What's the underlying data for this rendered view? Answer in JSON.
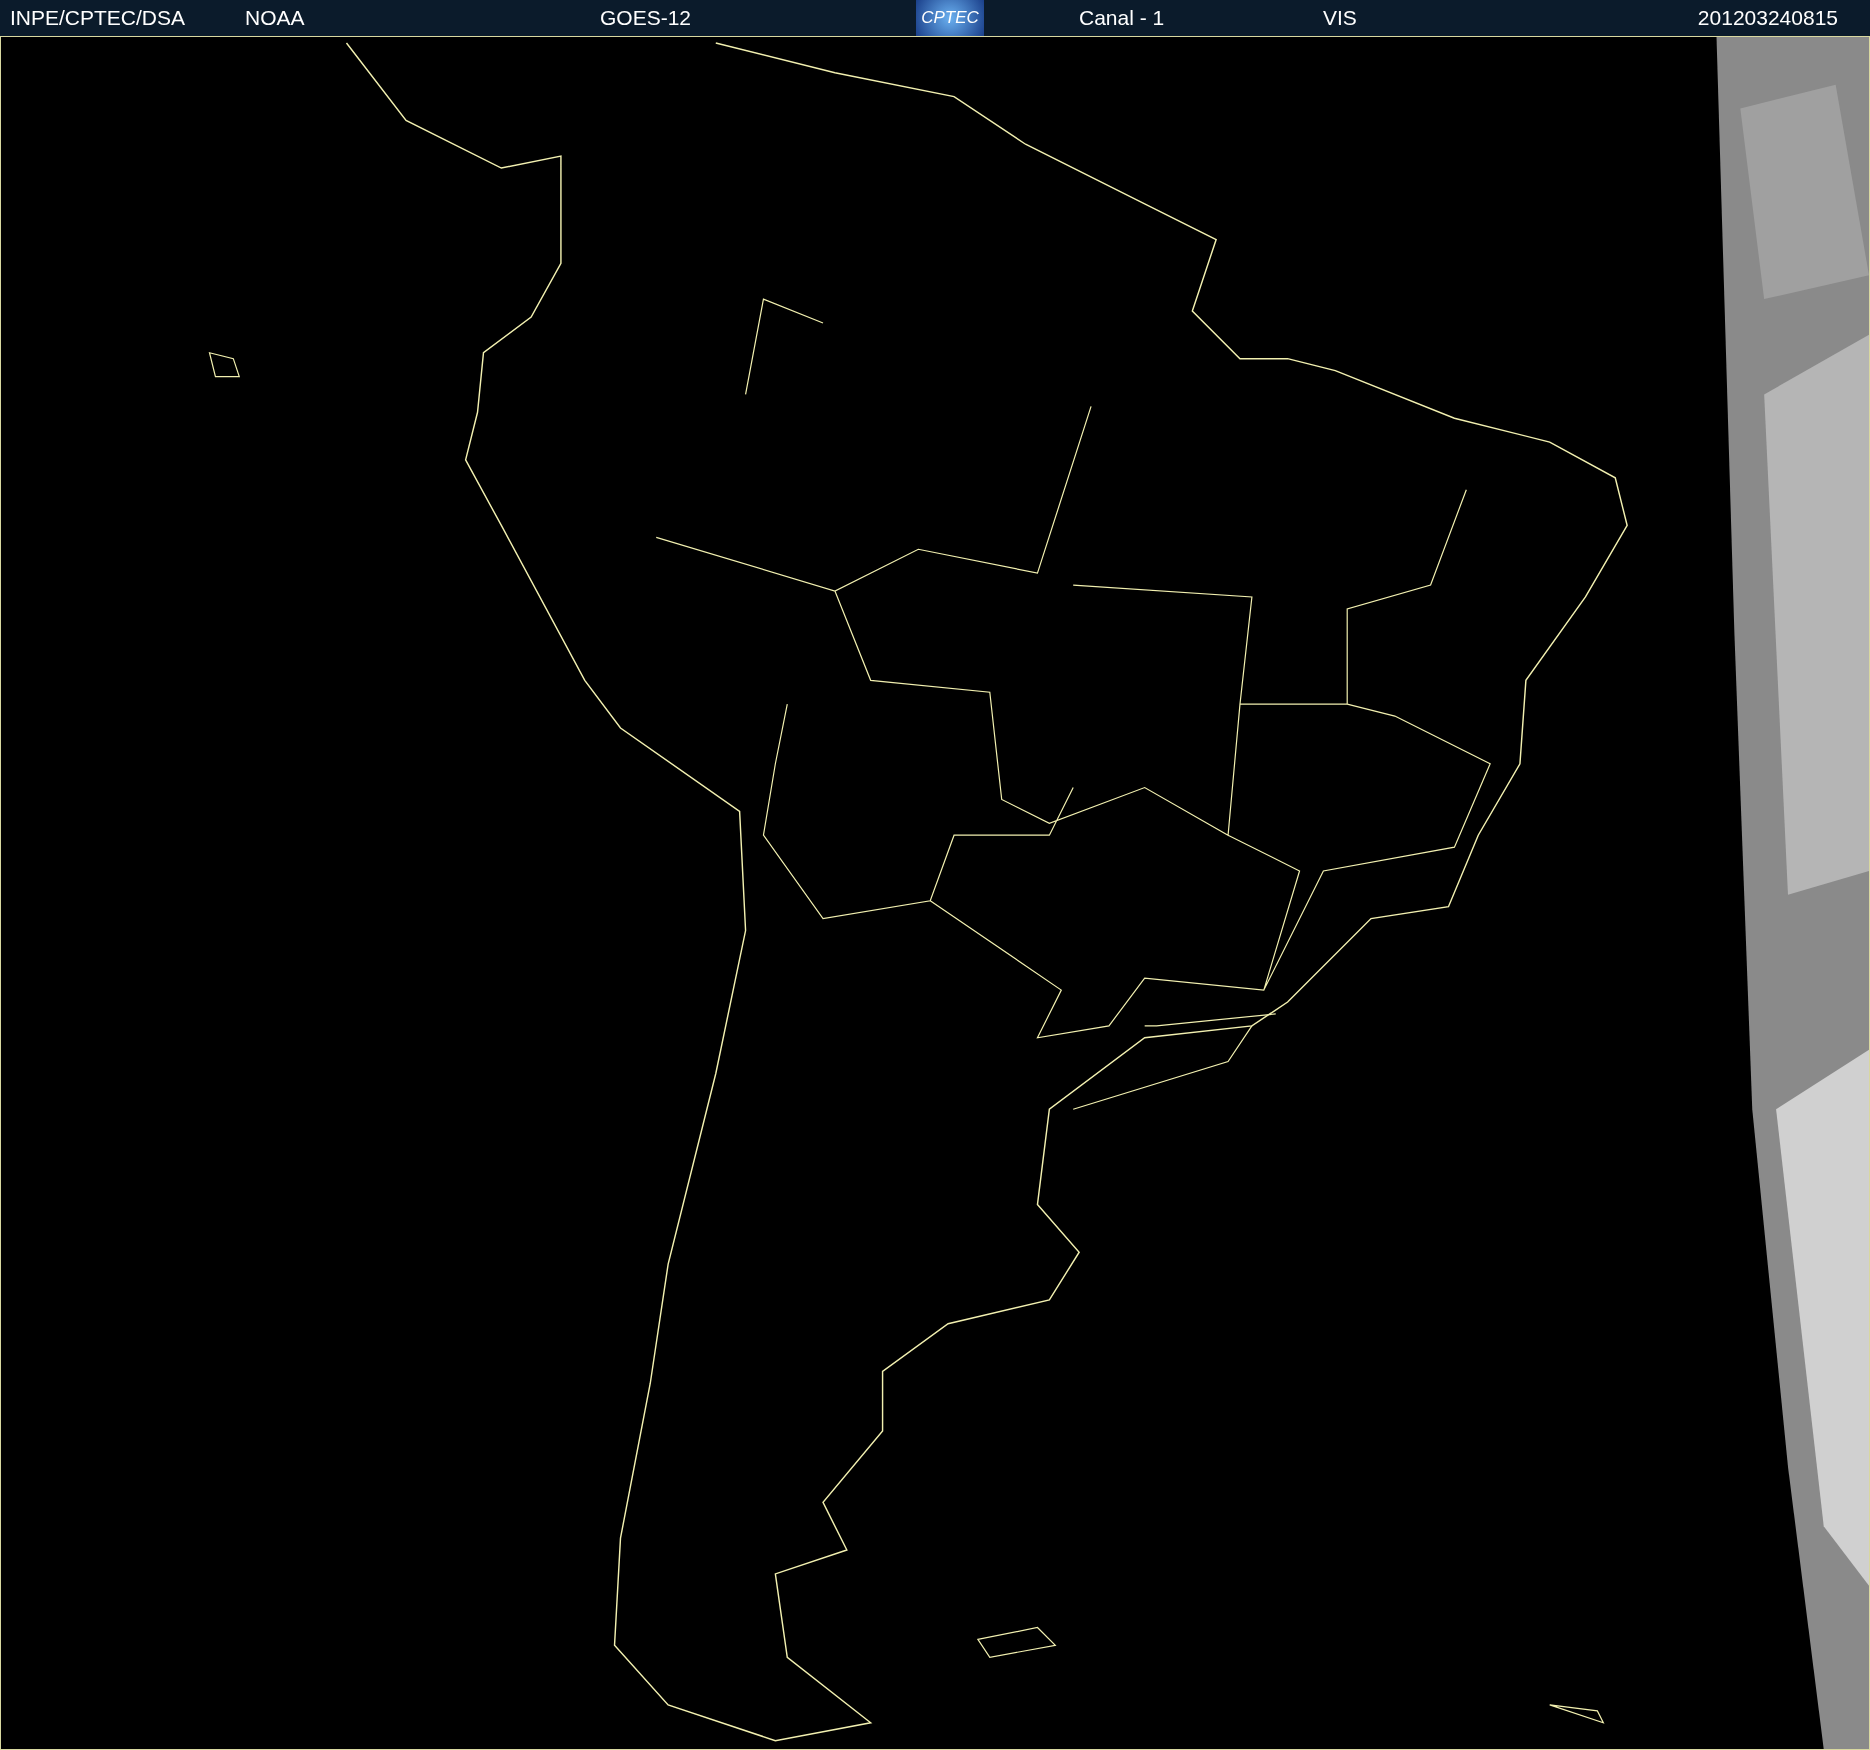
{
  "header": {
    "source": "INPE/CPTEC/DSA",
    "agency": "NOAA",
    "satellite": "GOES-12",
    "logo": "CPTEC",
    "channel": "Canal - 1",
    "band": "VIS",
    "timestamp": "201203240815"
  }
}
